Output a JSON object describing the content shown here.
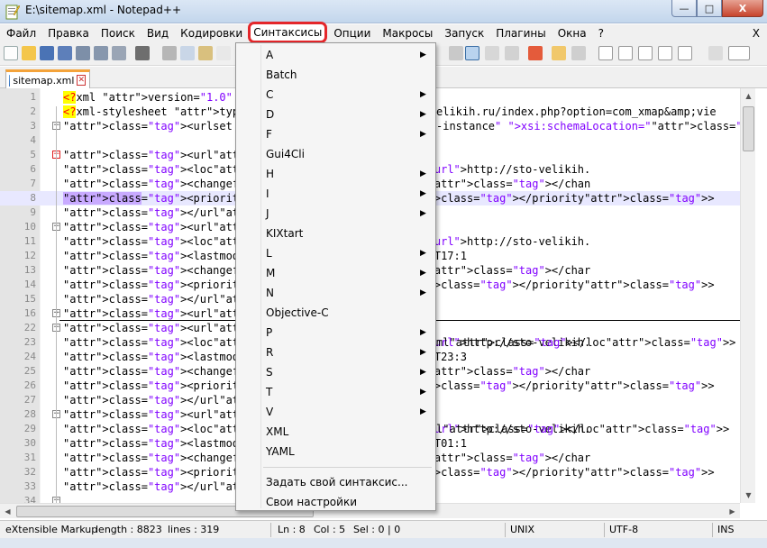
{
  "window": {
    "title": "E:\\sitemap.xml - Notepad++",
    "minimize": "—",
    "maximize": "□",
    "close": "X"
  },
  "menubar": {
    "items": [
      "Файл",
      "Правка",
      "Поиск",
      "Вид",
      "Кодировки",
      "Синтаксисы",
      "Опции",
      "Макросы",
      "Запуск",
      "Плагины",
      "Окна",
      "?"
    ],
    "highlighted_index": 5,
    "close_label": "X"
  },
  "tabs": [
    {
      "label": "sitemap.xml",
      "active": true
    }
  ],
  "editor": {
    "lines": [
      {
        "n": "1",
        "code": "<?xml version=\"1.0\" enco"
      },
      {
        "n": "2",
        "code": "<?xml-stylesheet type=\"t",
        "right": "elikih.ru/index.php?option=com_xmap&amp;vie"
      },
      {
        "n": "3",
        "code": "<urlset xmlns:xsi=\"http:",
        "right": "-instance\" xsi:schemaLocation=\"http://www.s"
      },
      {
        "n": "4",
        "code": ""
      },
      {
        "n": "5",
        "code": "<url>"
      },
      {
        "n": "6",
        "code": "<loc>http://sto-velikih."
      },
      {
        "n": "7",
        "code": "<changefreq>weekly</chan"
      },
      {
        "n": "8",
        "code": "<priority>0.5</priority>"
      },
      {
        "n": "9",
        "code": "</url>"
      },
      {
        "n": "10",
        "code": "<url>"
      },
      {
        "n": "11",
        "code": "<loc>http://sto-velikih."
      },
      {
        "n": "12",
        "code": "<lastmod>2014-01-11T17:1"
      },
      {
        "n": "13",
        "code": "<changefreq>weekly</char"
      },
      {
        "n": "14",
        "code": "<priority>0.5</priority>"
      },
      {
        "n": "15",
        "code": "</url>"
      },
      {
        "n": "16",
        "code": "<url>"
      },
      {
        "n": "22",
        "code": "<url>"
      },
      {
        "n": "23",
        "code": "<loc>http://sto-velikih.",
        "right": "ml</loc>"
      },
      {
        "n": "24",
        "code": "<lastmod>2014-01-04T23:3"
      },
      {
        "n": "25",
        "code": "<changefreq>weekly</char"
      },
      {
        "n": "26",
        "code": "<priority>0.5</priority>"
      },
      {
        "n": "27",
        "code": "</url>"
      },
      {
        "n": "28",
        "code": "<url>"
      },
      {
        "n": "29",
        "code": "<loc>http://sto-velikih.",
        "right": "l</loc>"
      },
      {
        "n": "30",
        "code": "<lastmod>2014-01-09T01:1"
      },
      {
        "n": "31",
        "code": "<changefreq>weekly</char"
      },
      {
        "n": "32",
        "code": "<priority>0.5</priority>"
      },
      {
        "n": "33",
        "code": "</url>"
      },
      {
        "n": "34",
        "code": ""
      }
    ]
  },
  "syntax_menu": {
    "items": [
      {
        "label": "A",
        "submenu": true
      },
      {
        "label": "Batch",
        "submenu": false
      },
      {
        "label": "C",
        "submenu": true
      },
      {
        "label": "D",
        "submenu": true
      },
      {
        "label": "F",
        "submenu": true
      },
      {
        "label": "Gui4Cli",
        "submenu": false
      },
      {
        "label": "H",
        "submenu": true
      },
      {
        "label": "I",
        "submenu": true
      },
      {
        "label": "J",
        "submenu": true
      },
      {
        "label": "KIXtart",
        "submenu": false
      },
      {
        "label": "L",
        "submenu": true
      },
      {
        "label": "M",
        "submenu": true
      },
      {
        "label": "N",
        "submenu": true
      },
      {
        "label": "Objective-C",
        "submenu": false
      },
      {
        "label": "P",
        "submenu": true
      },
      {
        "label": "R",
        "submenu": true
      },
      {
        "label": "S",
        "submenu": true
      },
      {
        "label": "T",
        "submenu": true
      },
      {
        "label": "V",
        "submenu": true
      },
      {
        "label": "XML",
        "submenu": false
      },
      {
        "label": "YAML",
        "submenu": false
      }
    ],
    "footer_items": [
      "Задать свой синтаксис...",
      "Свои настройки"
    ]
  },
  "statusbar": {
    "filetype": "eXtensible Markup",
    "length": "length : 8823",
    "lines": "lines : 319",
    "ln": "Ln : 8",
    "col": "Col : 5",
    "sel": "Sel : 0 | 0",
    "eol": "UNIX",
    "encoding": "UTF-8",
    "mode": "INS"
  },
  "colors": {
    "highlight_box": "#e4262a",
    "tag": "#0000ff",
    "attr": "#ff0000",
    "string": "#8000ff"
  }
}
